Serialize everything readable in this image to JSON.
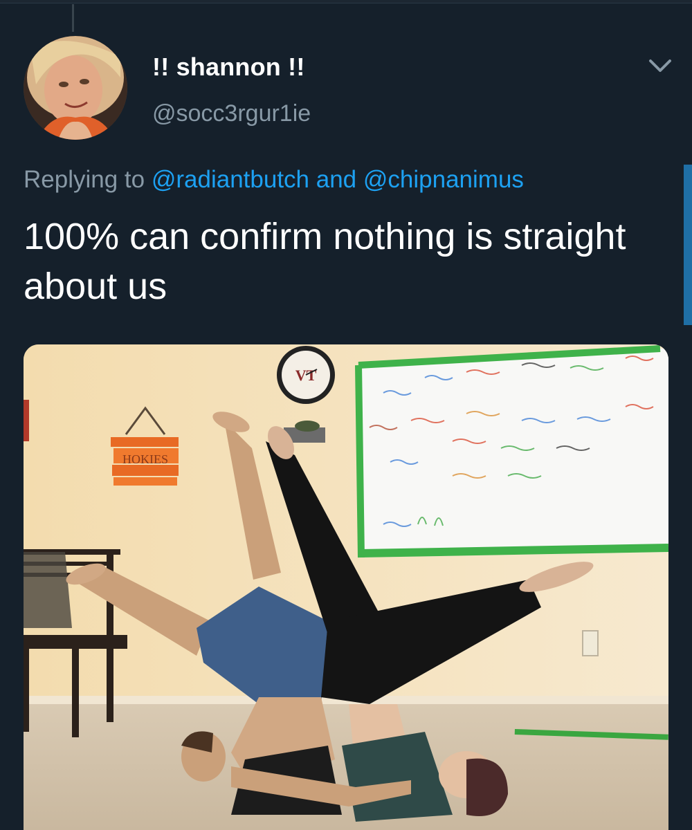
{
  "tweet": {
    "display_name": "!! shannon !!",
    "handle": "@socc3rgur1ie",
    "reply_prefix": "Replying to",
    "reply_mention_1": "@radiantbutch",
    "reply_conjunction": "and",
    "reply_mention_2": "@chipnanimus",
    "text": "100% can confirm nothing is straight about us"
  },
  "photo": {
    "sign_text": "HOKIES",
    "clock_logo": "VT"
  },
  "colors": {
    "background": "#15202b",
    "mention": "#1da1f2",
    "secondary_text": "#8899a6",
    "primary_text": "#ffffff"
  },
  "icons": {
    "menu": "chevron-down-icon"
  }
}
